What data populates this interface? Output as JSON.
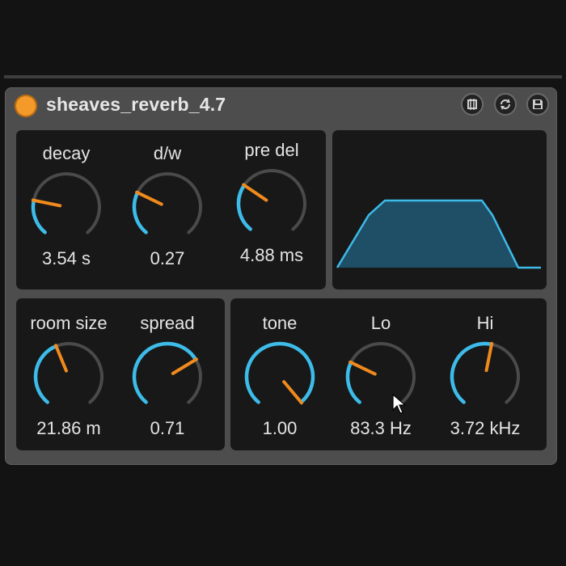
{
  "device": {
    "title": "sheaves_reverb_4.7",
    "power_color": "#f39a2b",
    "icons": [
      "hot-swap-icon",
      "refresh-icon",
      "save-icon"
    ]
  },
  "colors": {
    "arc_active": "#3dbbe9",
    "arc_track": "#4a4a4a",
    "pointer": "#f08a1c",
    "graph_fill": "#1f4f66",
    "graph_stroke": "#3dbbe9"
  },
  "knobs": {
    "decay": {
      "label": "decay",
      "value": "3.54 s",
      "level": 0.22
    },
    "dw": {
      "label": "d/w",
      "value": "0.27",
      "level": 0.27
    },
    "predel": {
      "label": "pre del",
      "value": "4.88 ms",
      "level": 0.3
    },
    "roomsize": {
      "label": "room size",
      "value": "21.86 m",
      "level": 0.42
    },
    "spread": {
      "label": "spread",
      "value": "0.71",
      "level": 0.71
    },
    "tone": {
      "label": "tone",
      "value": "1.00",
      "level": 1.0
    },
    "lo": {
      "label": "Lo",
      "value": "83.3 Hz",
      "level": 0.27
    },
    "hi": {
      "label": "Hi",
      "value": "3.72 kHz",
      "level": 0.54
    }
  }
}
